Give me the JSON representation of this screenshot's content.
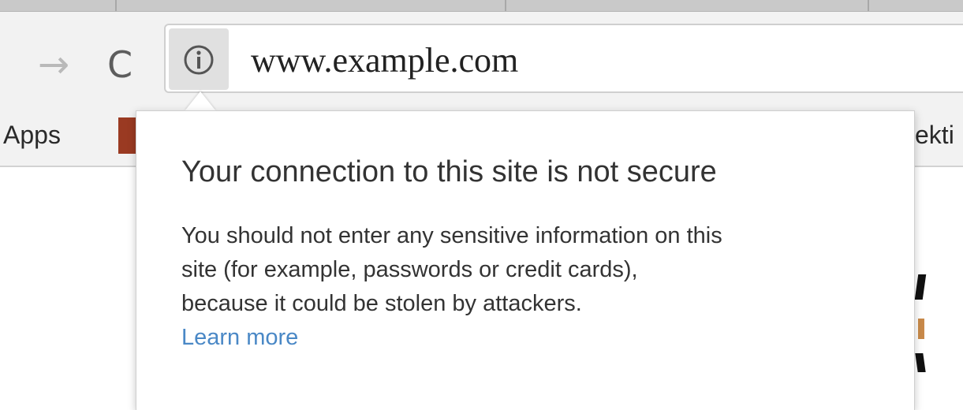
{
  "toolbar": {
    "forward_icon": "arrow-right-icon",
    "reload_icon": "reload-icon",
    "site_info_icon": "info-circle-icon",
    "url": "www.example.com"
  },
  "bookmarks_bar": {
    "apps_label": "Apps",
    "right_label": "ekti"
  },
  "popup": {
    "title": "Your connection to this site is not secure",
    "body_lines": [
      "You should not enter any sensitive information on this",
      "site (for example, passwords or credit cards),",
      "because it could be stolen by attackers."
    ],
    "learn_more": "Learn more"
  },
  "colors": {
    "link": "#4a88c6",
    "text": "#333333",
    "toolbar_bg": "#f2f2f2",
    "icon_bg": "#e0e0e0"
  }
}
